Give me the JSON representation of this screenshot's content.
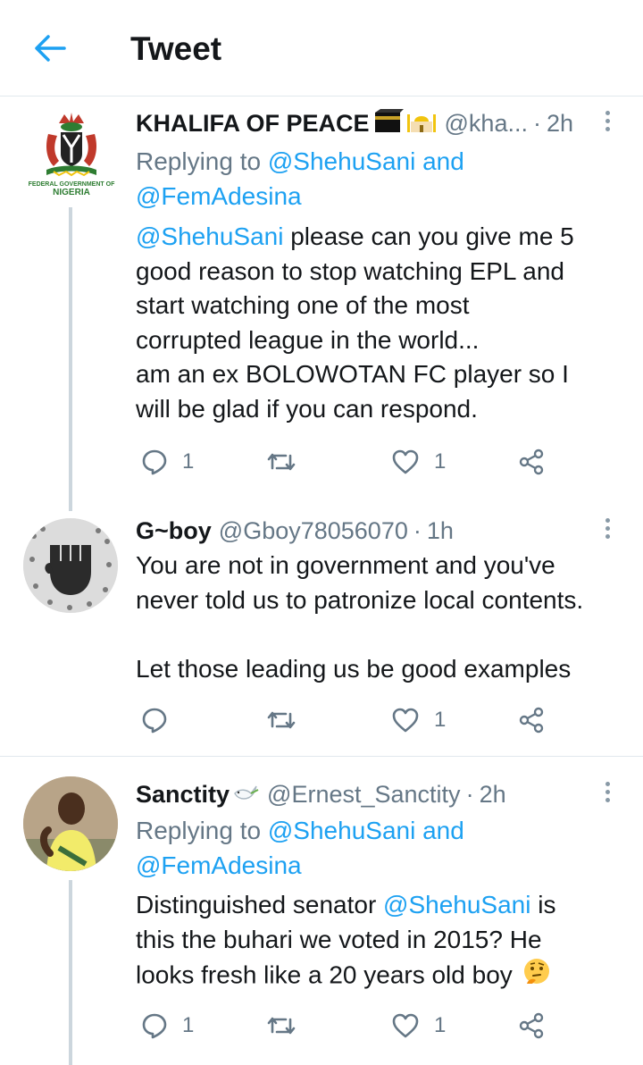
{
  "header": {
    "title": "Tweet",
    "back_icon": "arrow-left-icon"
  },
  "tweets": [
    {
      "name": "KHALIFA OF PEACE",
      "name_emoji": "kaaba-mosque",
      "handle": "@kha...",
      "sep": "·",
      "time": "2h",
      "replying_prefix": "Replying to",
      "replying_1": "@ShehuSani",
      "replying_and": "and",
      "replying_2": "@FemAdesina",
      "mention": "@ShehuSani",
      "line1": " please can you give me 5",
      "line2": "good reason to stop watching EPL and",
      "line3": "start watching one of the most",
      "line4": "corrupted league in the world...",
      "line5": "am an ex BOLOWOTAN FC player so I",
      "line6": "will be glad if you can respond.",
      "avatar_text_1": "FEDERAL GOVERNMENT OF",
      "avatar_text_2": "NIGERIA",
      "replies": "1",
      "retweets": "",
      "likes": "1"
    },
    {
      "name": "G~boy",
      "handle": "@Gboy78056070",
      "sep": "·",
      "time": "1h",
      "line1": "You are not in government and you've",
      "line2": "never told us to patronize local contents.",
      "line3": "Let those leading us be good examples",
      "replies": "",
      "retweets": "",
      "likes": "1"
    },
    {
      "name": "Sanctity",
      "name_emoji": "dove",
      "handle": "@Ernest_Sanctity",
      "sep": "·",
      "time": "2h",
      "replying_prefix": "Replying to",
      "replying_1": "@ShehuSani",
      "replying_and": "and",
      "replying_2": "@FemAdesina",
      "line1a": "Distinguished senator ",
      "mention": "@ShehuSani",
      "line1b": " is",
      "line2": "this the buhari we voted in 2015? He",
      "line3": "looks fresh like a 20 years old boy",
      "line3_emoji": "thinking-face",
      "replies": "1",
      "retweets": "",
      "likes": "1"
    }
  ],
  "colors": {
    "link": "#1da1f2",
    "secondary": "#657786",
    "text": "#14171a",
    "divider": "#e1e8ed",
    "thread": "#ccd6dd"
  }
}
